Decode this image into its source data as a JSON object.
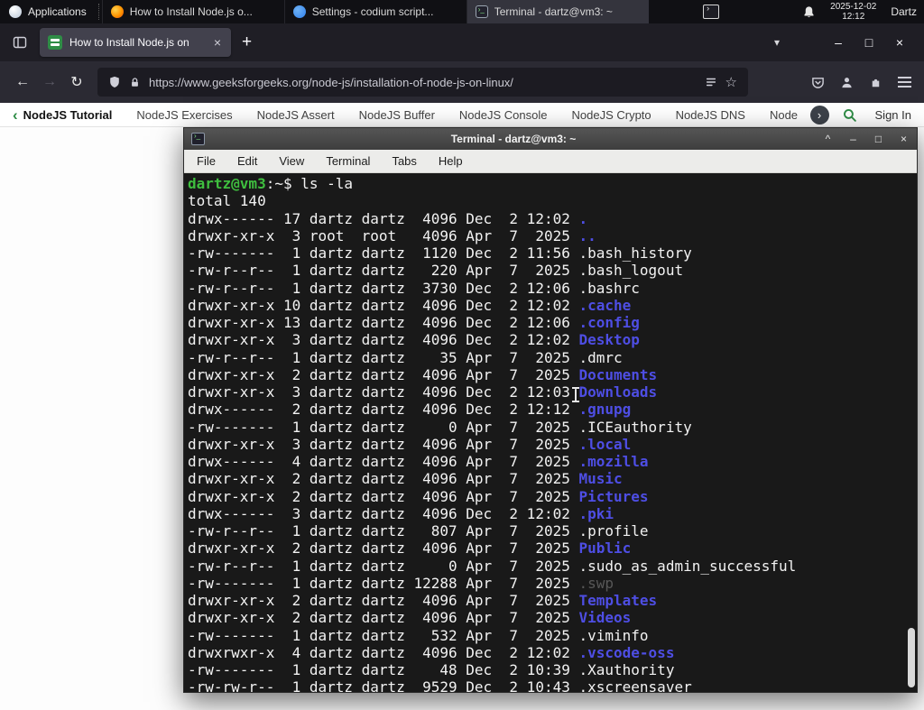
{
  "panel": {
    "applications": "Applications",
    "windows": [
      {
        "title": "How to Install Node.js o...",
        "app": "firefox",
        "active": false
      },
      {
        "title": "Settings - codium script...",
        "app": "codium",
        "active": false
      },
      {
        "title": "Terminal - dartz@vm3: ~",
        "app": "terminal",
        "active": true
      }
    ],
    "clock": {
      "date": "2025-12-02",
      "time": "12:12"
    },
    "user": "Dartz"
  },
  "browser": {
    "tab": {
      "title": "How to Install Node.js on",
      "close": "×"
    },
    "new_tab": "+",
    "window_controls": {
      "list_tabs": "▾",
      "minimize": "–",
      "maximize": "□",
      "close": "×"
    },
    "nav": {
      "back": "←",
      "forward": "→",
      "reload": "↻"
    },
    "urlbar": {
      "url": "https://www.geeksforgeeks.org/node-js/installation-of-node-js-on-linux/",
      "star": "☆"
    },
    "site_nav": {
      "accent": "#2f8d46",
      "back_chevron": "‹",
      "next_chevron": "›",
      "links": [
        "NodeJS Tutorial",
        "NodeJS Exercises",
        "NodeJS Assert",
        "NodeJS Buffer",
        "NodeJS Console",
        "NodeJS Crypto",
        "NodeJS DNS",
        "Node"
      ],
      "sign_in": "Sign In"
    }
  },
  "terminal": {
    "title": "Terminal - dartz@vm3: ~",
    "menu": [
      "File",
      "Edit",
      "View",
      "Terminal",
      "Tabs",
      "Help"
    ],
    "window_controls": {
      "shade": "^",
      "minimize": "–",
      "maximize": "□",
      "close": "×"
    },
    "prompt": {
      "user_host": "dartz@vm3",
      "path_suffix": ":~$",
      "command": "ls -la"
    },
    "output_total": "total 140",
    "colors": {
      "prompt": "#3fbf3f",
      "directory": "#4e4ee4",
      "file": "#f2f2f2",
      "dim": "#585858",
      "background": "#191919"
    },
    "files": [
      {
        "pre": "drwx------ 17 dartz dartz  4096 Dec  2 12:02 ",
        "name": ".",
        "type": "dir"
      },
      {
        "pre": "drwxr-xr-x  3 root  root   4096 Apr  7  2025 ",
        "name": "..",
        "type": "dir"
      },
      {
        "pre": "-rw-------  1 dartz dartz  1120 Dec  2 11:56 ",
        "name": ".bash_history",
        "type": "file"
      },
      {
        "pre": "-rw-r--r--  1 dartz dartz   220 Apr  7  2025 ",
        "name": ".bash_logout",
        "type": "file"
      },
      {
        "pre": "-rw-r--r--  1 dartz dartz  3730 Dec  2 12:06 ",
        "name": ".bashrc",
        "type": "file"
      },
      {
        "pre": "drwxr-xr-x 10 dartz dartz  4096 Dec  2 12:02 ",
        "name": ".cache",
        "type": "dir"
      },
      {
        "pre": "drwxr-xr-x 13 dartz dartz  4096 Dec  2 12:06 ",
        "name": ".config",
        "type": "dir"
      },
      {
        "pre": "drwxr-xr-x  3 dartz dartz  4096 Dec  2 12:02 ",
        "name": "Desktop",
        "type": "dir"
      },
      {
        "pre": "-rw-r--r--  1 dartz dartz    35 Apr  7  2025 ",
        "name": ".dmrc",
        "type": "file"
      },
      {
        "pre": "drwxr-xr-x  2 dartz dartz  4096 Apr  7  2025 ",
        "name": "Documents",
        "type": "dir"
      },
      {
        "pre": "drwxr-xr-x  3 dartz dartz  4096 Dec  2 12:03 ",
        "name": "Downloads",
        "type": "dir"
      },
      {
        "pre": "drwx------  2 dartz dartz  4096 Dec  2 12:12 ",
        "name": ".gnupg",
        "type": "dir"
      },
      {
        "pre": "-rw-------  1 dartz dartz     0 Apr  7  2025 ",
        "name": ".ICEauthority",
        "type": "file"
      },
      {
        "pre": "drwxr-xr-x  3 dartz dartz  4096 Apr  7  2025 ",
        "name": ".local",
        "type": "dir"
      },
      {
        "pre": "drwx------  4 dartz dartz  4096 Apr  7  2025 ",
        "name": ".mozilla",
        "type": "dir"
      },
      {
        "pre": "drwxr-xr-x  2 dartz dartz  4096 Apr  7  2025 ",
        "name": "Music",
        "type": "dir"
      },
      {
        "pre": "drwxr-xr-x  2 dartz dartz  4096 Apr  7  2025 ",
        "name": "Pictures",
        "type": "dir"
      },
      {
        "pre": "drwx------  3 dartz dartz  4096 Dec  2 12:02 ",
        "name": ".pki",
        "type": "dir"
      },
      {
        "pre": "-rw-r--r--  1 dartz dartz   807 Apr  7  2025 ",
        "name": ".profile",
        "type": "file"
      },
      {
        "pre": "drwxr-xr-x  2 dartz dartz  4096 Apr  7  2025 ",
        "name": "Public",
        "type": "dir"
      },
      {
        "pre": "-rw-r--r--  1 dartz dartz     0 Apr  7  2025 ",
        "name": ".sudo_as_admin_successful",
        "type": "file"
      },
      {
        "pre": "-rw-------  1 dartz dartz 12288 Apr  7  2025 ",
        "name": ".swp",
        "type": "dim"
      },
      {
        "pre": "drwxr-xr-x  2 dartz dartz  4096 Apr  7  2025 ",
        "name": "Templates",
        "type": "dir"
      },
      {
        "pre": "drwxr-xr-x  2 dartz dartz  4096 Apr  7  2025 ",
        "name": "Videos",
        "type": "dir"
      },
      {
        "pre": "-rw-------  1 dartz dartz   532 Apr  7  2025 ",
        "name": ".viminfo",
        "type": "file"
      },
      {
        "pre": "drwxrwxr-x  4 dartz dartz  4096 Dec  2 12:02 ",
        "name": ".vscode-oss",
        "type": "dir"
      },
      {
        "pre": "-rw-------  1 dartz dartz    48 Dec  2 10:39 ",
        "name": ".Xauthority",
        "type": "file"
      },
      {
        "pre": "-rw-rw-r--  1 dartz dartz  9529 Dec  2 10:43 ",
        "name": ".xscreensaver",
        "type": "file"
      }
    ]
  }
}
